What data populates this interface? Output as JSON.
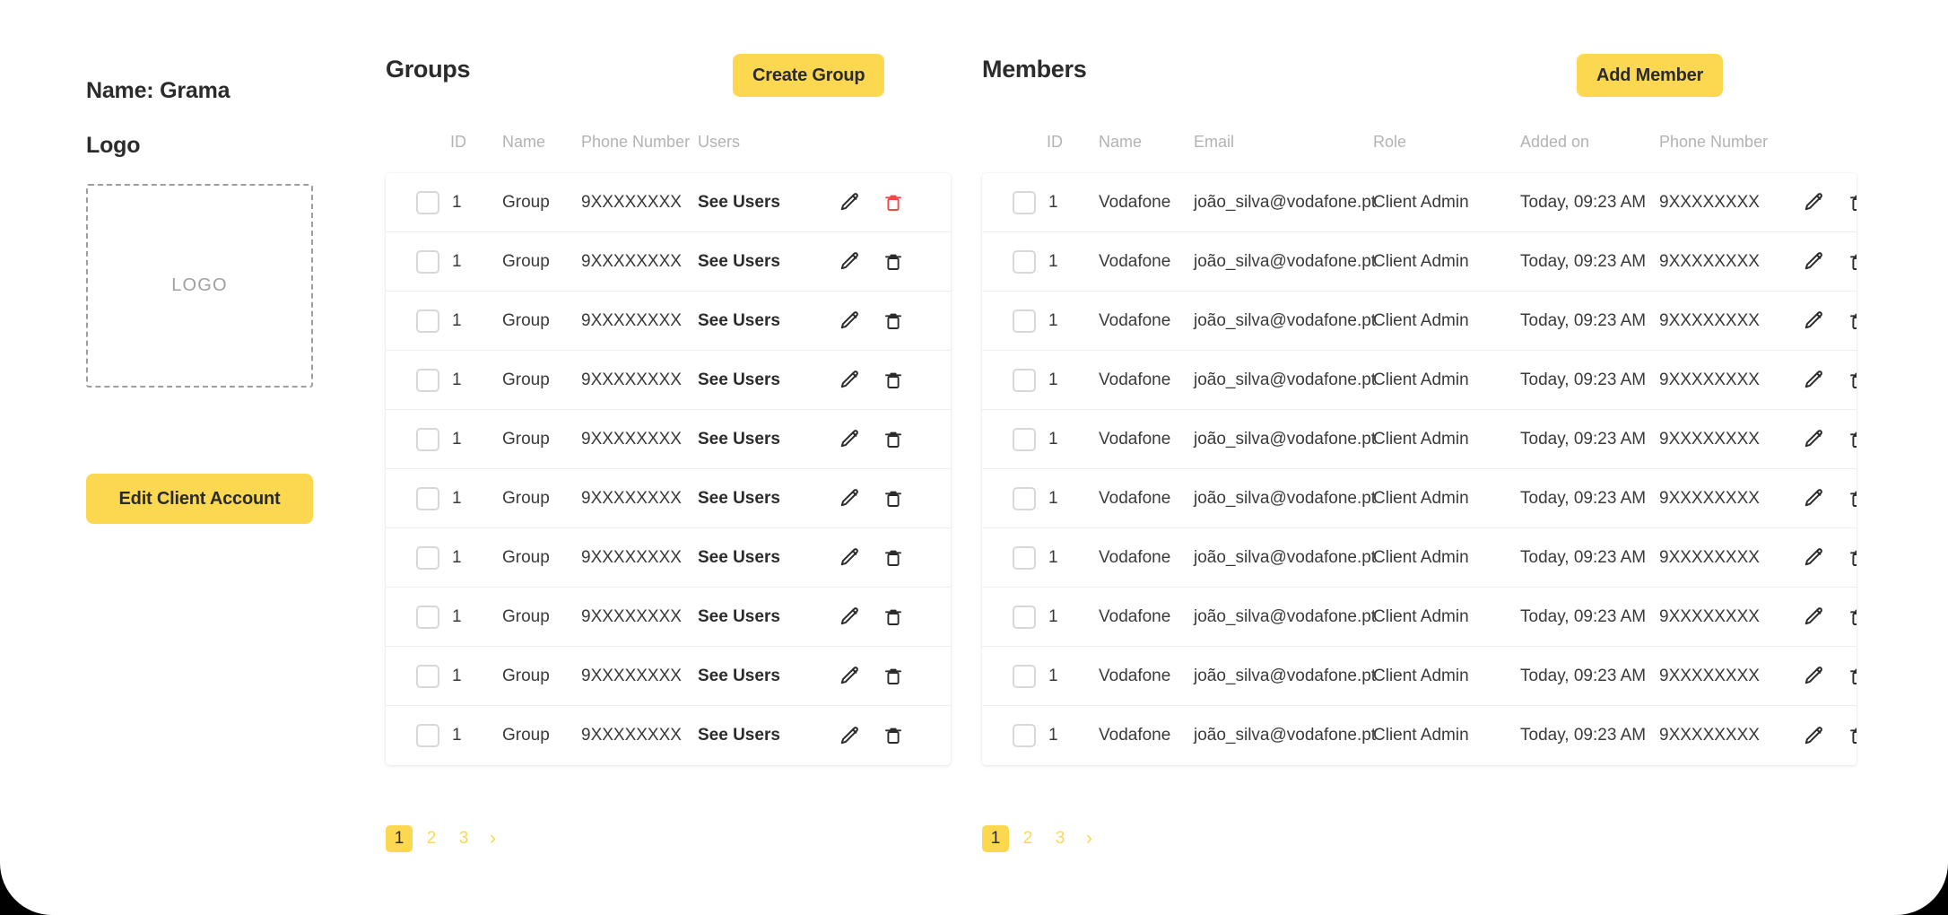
{
  "client": {
    "name_label": "Name: Grama",
    "logo_label": "Logo",
    "logo_placeholder": "LOGO",
    "edit_button": "Edit Client Account"
  },
  "theme": {
    "accent": "#FBD850",
    "danger": "#EF4A45",
    "text": "#2b2b2b",
    "muted": "#b3b3b3"
  },
  "groups": {
    "title": "Groups",
    "action_button": "Create Group",
    "columns": [
      "ID",
      "Name",
      "Phone Number",
      "Users"
    ],
    "rows": [
      {
        "id": "1",
        "name": "Group",
        "phone": "9XXXXXXXX",
        "users": "See Users",
        "delete_state": "danger"
      },
      {
        "id": "1",
        "name": "Group",
        "phone": "9XXXXXXXX",
        "users": "See Users",
        "delete_state": "normal"
      },
      {
        "id": "1",
        "name": "Group",
        "phone": "9XXXXXXXX",
        "users": "See Users",
        "delete_state": "normal"
      },
      {
        "id": "1",
        "name": "Group",
        "phone": "9XXXXXXXX",
        "users": "See Users",
        "delete_state": "normal"
      },
      {
        "id": "1",
        "name": "Group",
        "phone": "9XXXXXXXX",
        "users": "See Users",
        "delete_state": "normal"
      },
      {
        "id": "1",
        "name": "Group",
        "phone": "9XXXXXXXX",
        "users": "See Users",
        "delete_state": "normal"
      },
      {
        "id": "1",
        "name": "Group",
        "phone": "9XXXXXXXX",
        "users": "See Users",
        "delete_state": "normal"
      },
      {
        "id": "1",
        "name": "Group",
        "phone": "9XXXXXXXX",
        "users": "See Users",
        "delete_state": "normal"
      },
      {
        "id": "1",
        "name": "Group",
        "phone": "9XXXXXXXX",
        "users": "See Users",
        "delete_state": "normal"
      },
      {
        "id": "1",
        "name": "Group",
        "phone": "9XXXXXXXX",
        "users": "See Users",
        "delete_state": "normal"
      }
    ],
    "pagination": {
      "pages": [
        "1",
        "2",
        "3"
      ],
      "current": "1",
      "next_icon": "›"
    }
  },
  "members": {
    "title": "Members",
    "action_button": "Add Member",
    "columns": [
      "ID",
      "Name",
      "Email",
      "Role",
      "Added on",
      "Phone Number"
    ],
    "rows": [
      {
        "id": "1",
        "name": "Vodafone",
        "email": "joão_silva@vodafone.pt",
        "role": "Client Admin",
        "added_on": "Today, 09:23 AM",
        "phone": "9XXXXXXXX"
      },
      {
        "id": "1",
        "name": "Vodafone",
        "email": "joão_silva@vodafone.pt",
        "role": "Client Admin",
        "added_on": "Today, 09:23 AM",
        "phone": "9XXXXXXXX"
      },
      {
        "id": "1",
        "name": "Vodafone",
        "email": "joão_silva@vodafone.pt",
        "role": "Client Admin",
        "added_on": "Today, 09:23 AM",
        "phone": "9XXXXXXXX"
      },
      {
        "id": "1",
        "name": "Vodafone",
        "email": "joão_silva@vodafone.pt",
        "role": "Client Admin",
        "added_on": "Today, 09:23 AM",
        "phone": "9XXXXXXXX"
      },
      {
        "id": "1",
        "name": "Vodafone",
        "email": "joão_silva@vodafone.pt",
        "role": "Client Admin",
        "added_on": "Today, 09:23 AM",
        "phone": "9XXXXXXXX"
      },
      {
        "id": "1",
        "name": "Vodafone",
        "email": "joão_silva@vodafone.pt",
        "role": "Client Admin",
        "added_on": "Today, 09:23 AM",
        "phone": "9XXXXXXXX"
      },
      {
        "id": "1",
        "name": "Vodafone",
        "email": "joão_silva@vodafone.pt",
        "role": "Client Admin",
        "added_on": "Today, 09:23 AM",
        "phone": "9XXXXXXXX"
      },
      {
        "id": "1",
        "name": "Vodafone",
        "email": "joão_silva@vodafone.pt",
        "role": "Client Admin",
        "added_on": "Today, 09:23 AM",
        "phone": "9XXXXXXXX"
      },
      {
        "id": "1",
        "name": "Vodafone",
        "email": "joão_silva@vodafone.pt",
        "role": "Client Admin",
        "added_on": "Today, 09:23 AM",
        "phone": "9XXXXXXXX"
      },
      {
        "id": "1",
        "name": "Vodafone",
        "email": "joão_silva@vodafone.pt",
        "role": "Client Admin",
        "added_on": "Today, 09:23 AM",
        "phone": "9XXXXXXXX"
      }
    ],
    "pagination": {
      "pages": [
        "1",
        "2",
        "3"
      ],
      "current": "1",
      "next_icon": "›"
    }
  },
  "icons": {
    "edit": "pencil-icon",
    "delete": "trash-icon",
    "next": "chevron-right-icon"
  }
}
